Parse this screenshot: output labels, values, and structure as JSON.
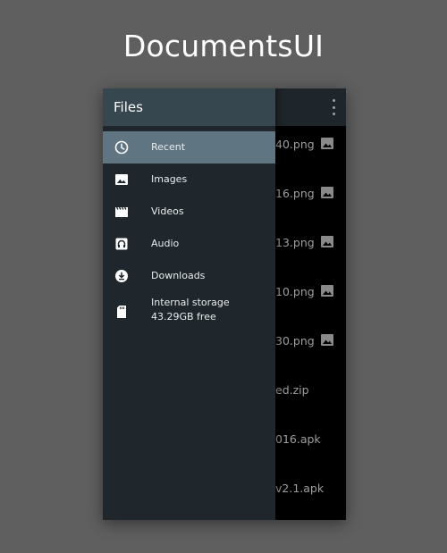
{
  "hero": {
    "title": "DocumentsUI"
  },
  "appbar": {
    "overflow_icon": "more-vert-icon"
  },
  "files": [
    {
      "name": "40.png",
      "thumb": "image-icon"
    },
    {
      "name": "16.png",
      "thumb": "image-icon"
    },
    {
      "name": "13.png",
      "thumb": "image-icon"
    },
    {
      "name": "10.png",
      "thumb": "image-icon"
    },
    {
      "name": "30.png",
      "thumb": "image-icon"
    },
    {
      "name": "ed.zip",
      "thumb": ""
    },
    {
      "name": "016.apk",
      "thumb": ""
    },
    {
      "name": "v2.1.apk",
      "thumb": ""
    }
  ],
  "drawer": {
    "title": "Files",
    "items": [
      {
        "label": "Recent",
        "icon": "clock-icon",
        "active": true
      },
      {
        "label": "Images",
        "icon": "image-icon",
        "active": false
      },
      {
        "label": "Videos",
        "icon": "movie-icon",
        "active": false
      },
      {
        "label": "Audio",
        "icon": "headphones-icon",
        "active": false
      },
      {
        "label": "Downloads",
        "icon": "download-icon",
        "active": false
      },
      {
        "label": "Internal storage",
        "sublabel": "43.29GB free",
        "icon": "sd-card-icon",
        "active": false
      }
    ]
  },
  "colors": {
    "background": "#5f5f5f",
    "drawer": "#1f272c",
    "drawer_header": "#37474f",
    "active_item": "#5f7581"
  }
}
